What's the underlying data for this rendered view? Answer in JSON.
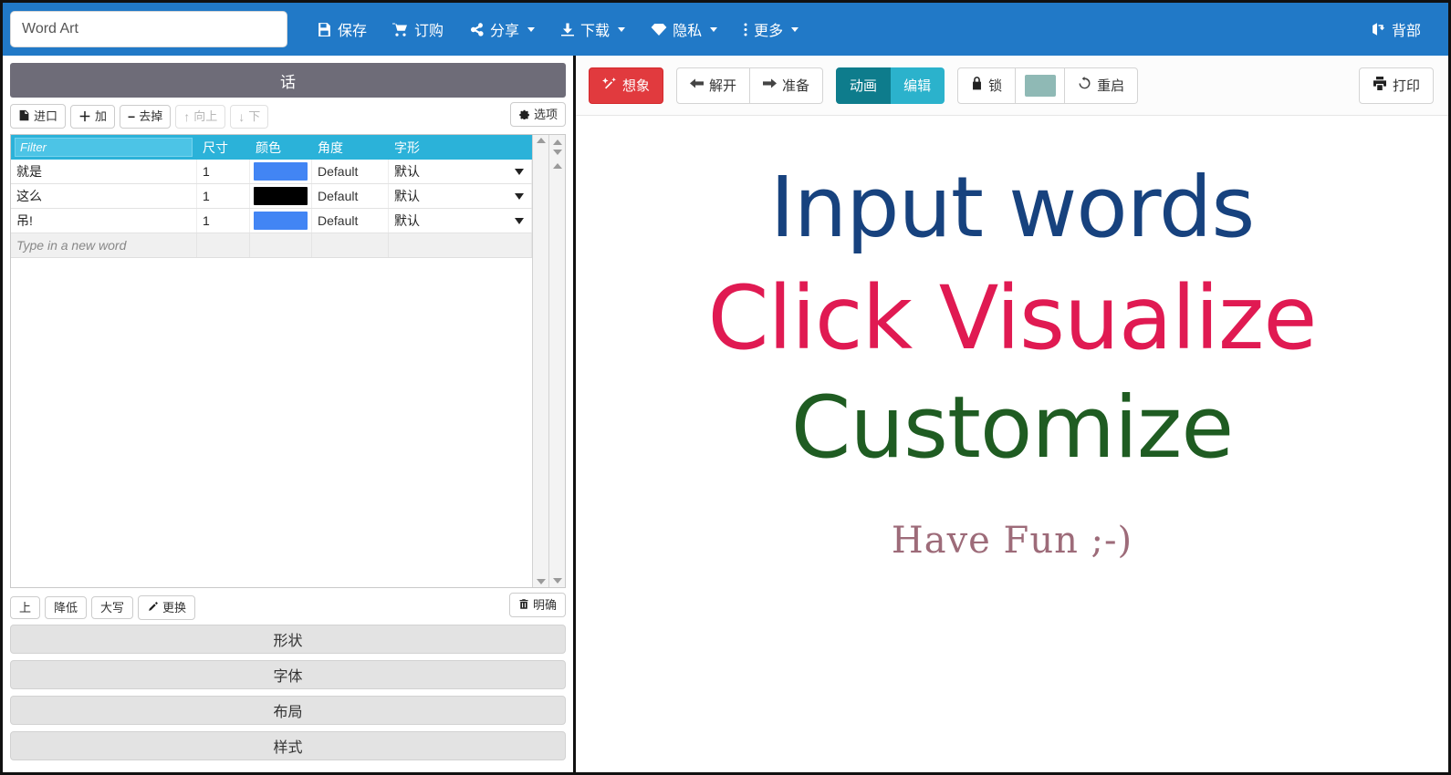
{
  "topbar": {
    "title_value": "Word Art",
    "title_placeholder": "Word Art",
    "menu": [
      {
        "label": "保存",
        "icon": "save-icon",
        "caret": false
      },
      {
        "label": "订购",
        "icon": "cart-icon",
        "caret": false
      },
      {
        "label": "分享",
        "icon": "share-icon",
        "caret": true
      },
      {
        "label": "下载",
        "icon": "download-icon",
        "caret": true
      },
      {
        "label": "隐私",
        "icon": "diamond-icon",
        "caret": true
      },
      {
        "label": "更多",
        "icon": "dots-vertical-icon",
        "caret": true
      }
    ],
    "back_label": "背部",
    "back_icon": "sign-in-icon",
    "background_color": "#2179c7"
  },
  "left_panel": {
    "header_title": "话",
    "toolbar": [
      {
        "label": "进口",
        "icon": "import-icon",
        "disabled": false
      },
      {
        "label": "加",
        "icon": "plus-icon",
        "disabled": false
      },
      {
        "label": "去掉",
        "icon": "minus-icon",
        "disabled": false
      },
      {
        "label": "向上",
        "icon": "arrow-up-icon",
        "disabled": true
      },
      {
        "label": "下",
        "icon": "arrow-down-icon",
        "disabled": true
      }
    ],
    "options_label": "选项",
    "options_icon": "gear-icon",
    "table": {
      "filter_placeholder": "Filter",
      "filter_value": "",
      "columns": [
        "尺寸",
        "颜色",
        "角度",
        "字形"
      ],
      "rows": [
        {
          "word": "就是",
          "size": "1",
          "color": "#4285f4",
          "angle": "Default",
          "font": "默认"
        },
        {
          "word": "这么",
          "size": "1",
          "color": "#000000",
          "angle": "Default",
          "font": "默认"
        },
        {
          "word": "吊!",
          "size": "1",
          "color": "#4285f4",
          "angle": "Default",
          "font": "默认"
        }
      ],
      "new_row_placeholder": "Type in a new word",
      "header_color": "#2bb2d9"
    },
    "bottom_toolbar": [
      {
        "label": "上",
        "icon": "",
        "disabled": false
      },
      {
        "label": "降低",
        "icon": "",
        "disabled": false
      },
      {
        "label": "大写",
        "icon": "",
        "disabled": false
      },
      {
        "label": "更换",
        "icon": "edit-icon",
        "disabled": false
      }
    ],
    "clear_label": "明确",
    "clear_icon": "trash-icon",
    "accordion": [
      {
        "label": "形状"
      },
      {
        "label": "字体"
      },
      {
        "label": "布局"
      },
      {
        "label": "样式"
      }
    ]
  },
  "right_panel": {
    "toolbar": {
      "visualize_label": "想象",
      "visualize_icon": "magic-wand-icon",
      "visualize_color": "#e13a3e",
      "undo_label": "解开",
      "undo_icon": "arrow-left-icon",
      "redo_label": "准备",
      "redo_icon": "arrow-right-icon",
      "animate_label": "动画",
      "animate_color": "#0e7c8c",
      "edit_label": "编辑",
      "edit_color": "#2bb2cc",
      "lock_label": "锁",
      "lock_icon": "lock-icon",
      "swatch_color": "#8fb9b5",
      "restart_label": "重启",
      "restart_icon": "refresh-icon",
      "print_label": "打印",
      "print_icon": "printer-icon"
    },
    "canvas": {
      "lines": [
        {
          "text": "Input words",
          "color": "#17427e"
        },
        {
          "text": "Click Visualize",
          "color": "#e01a52"
        },
        {
          "text": "Customize",
          "color": "#1f5c22"
        },
        {
          "text": "Have Fun ;-)",
          "color": "#9d6b79"
        }
      ]
    }
  }
}
